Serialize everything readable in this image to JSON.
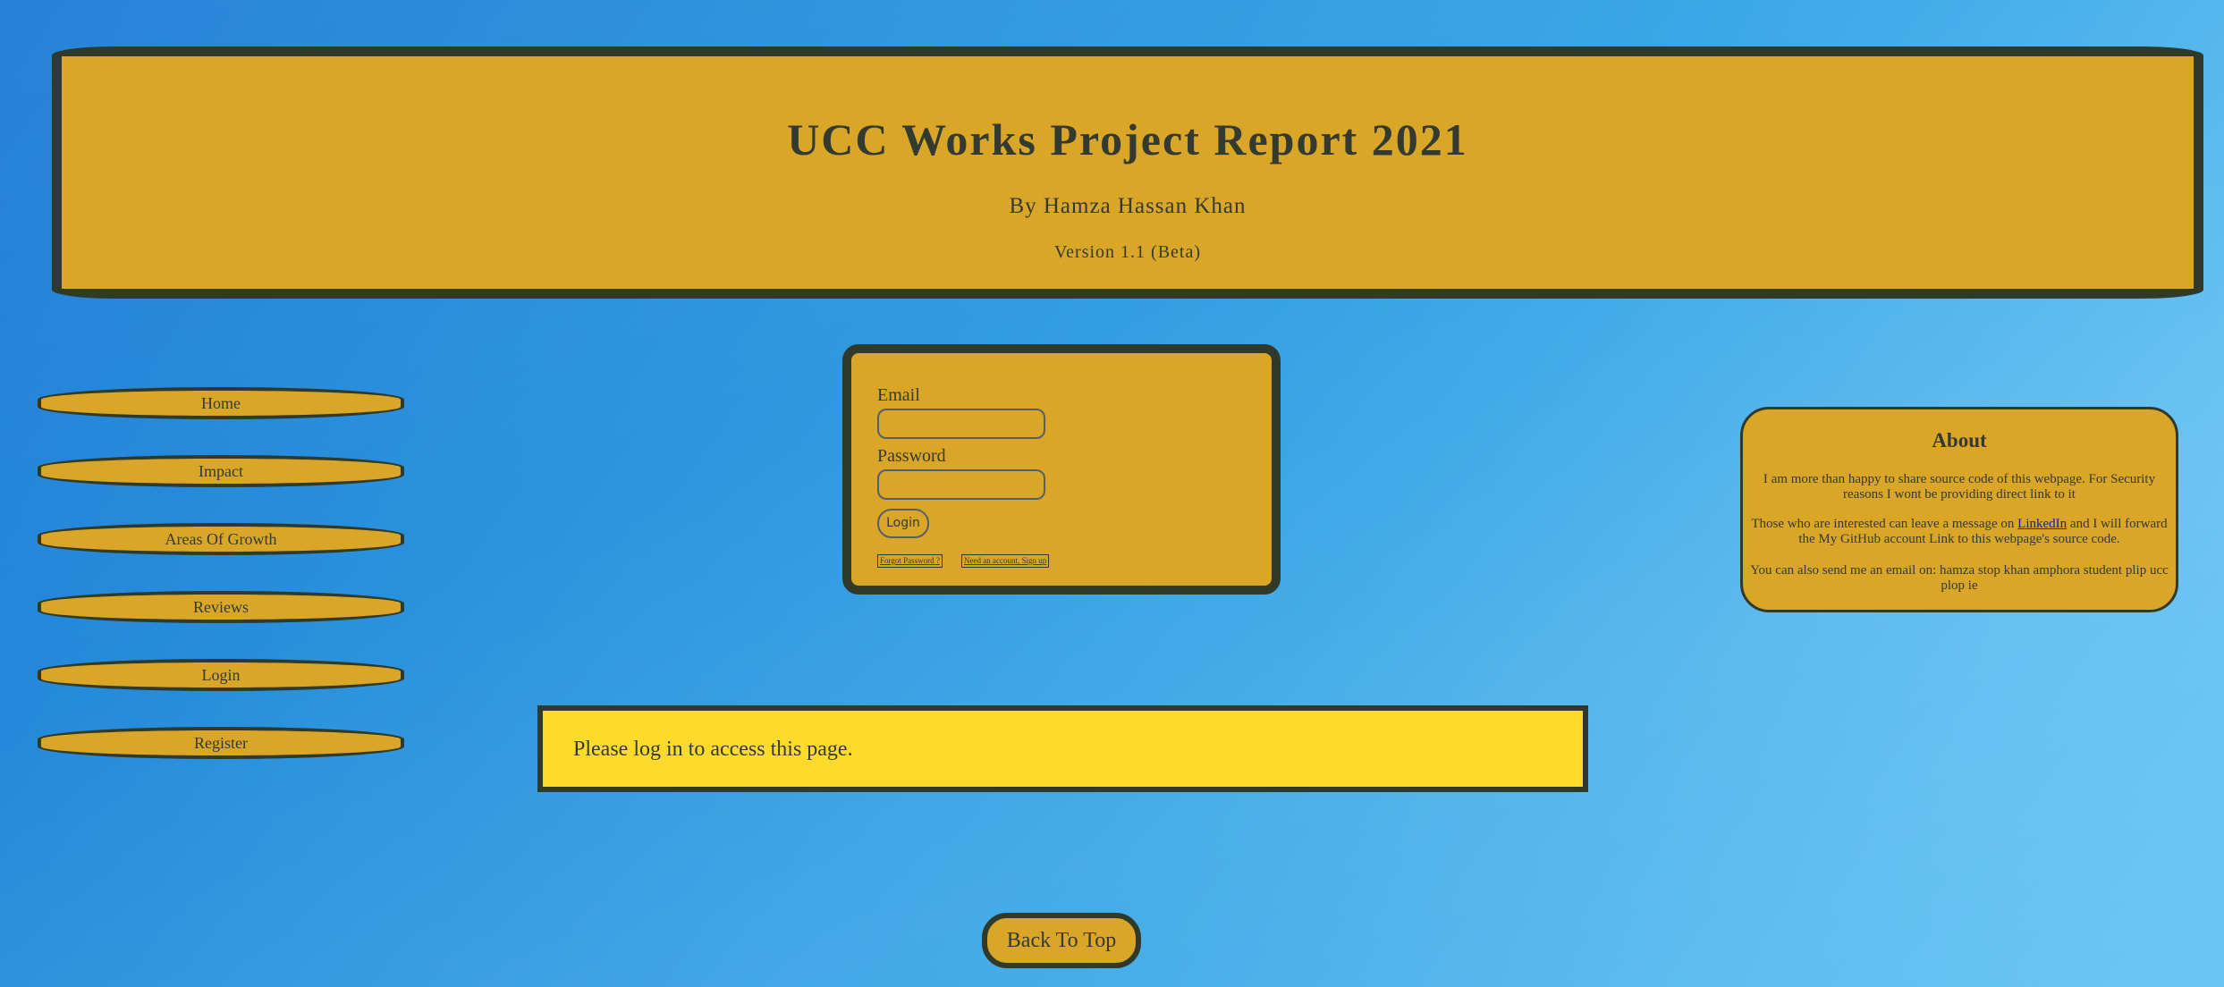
{
  "header": {
    "title": "UCC Works Project Report 2021",
    "author": "By Hamza Hassan Khan",
    "version": "Version 1.1 (Beta)"
  },
  "nav": {
    "items": [
      {
        "label": "Home"
      },
      {
        "label": "Impact"
      },
      {
        "label": "Areas Of Growth"
      },
      {
        "label": "Reviews"
      },
      {
        "label": "Login"
      },
      {
        "label": "Register"
      }
    ]
  },
  "login": {
    "email_label": "Email",
    "email_value": "",
    "password_label": "Password",
    "password_value": "",
    "login_button": "Login",
    "forgot_link": "Forgot Password ?",
    "signup_link": "Need an account, Sign up"
  },
  "about": {
    "title": "About",
    "para1": "I am more than happy to share source code of this webpage. For Security reasons I wont be providing direct link to it",
    "para2_before": "Those who are interested can leave a message on ",
    "para2_link": "LinkedIn",
    "para2_after": " and I will forward the My GitHub account Link to this webpage's source code.",
    "para3": "You can also send me an email on: hamza stop khan amphora student plip ucc plop ie"
  },
  "alert": {
    "message": "Please log in to access this page."
  },
  "footer": {
    "back_to_top": "Back To Top"
  },
  "colors": {
    "panel": "#daa628",
    "border": "#2f3a2a",
    "alert": "#fedb2b",
    "link": "#1a0dcc"
  }
}
